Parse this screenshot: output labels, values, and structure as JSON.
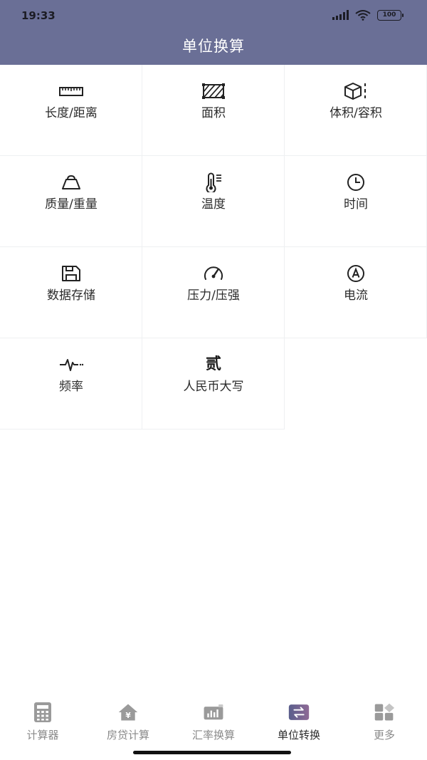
{
  "status": {
    "time": "19:33",
    "battery": "100"
  },
  "header": {
    "title": "单位换算"
  },
  "grid": {
    "items": [
      {
        "label": "长度/距离",
        "icon": "ruler-icon"
      },
      {
        "label": "面积",
        "icon": "area-icon"
      },
      {
        "label": "体积/容积",
        "icon": "cube-icon"
      },
      {
        "label": "质量/重量",
        "icon": "weight-icon"
      },
      {
        "label": "温度",
        "icon": "thermometer-icon"
      },
      {
        "label": "时间",
        "icon": "clock-icon"
      },
      {
        "label": "数据存储",
        "icon": "floppy-disk-icon"
      },
      {
        "label": "压力/压强",
        "icon": "gauge-icon"
      },
      {
        "label": "电流",
        "icon": "ampere-icon"
      },
      {
        "label": "频率",
        "icon": "pulse-wave-icon"
      },
      {
        "label": "人民币大写",
        "icon": "chinese-numeral-icon",
        "glyph": "贰"
      }
    ]
  },
  "tabbar": {
    "tabs": [
      {
        "label": "计算器",
        "icon": "calculator-icon"
      },
      {
        "label": "房贷计算",
        "icon": "house-yuan-icon"
      },
      {
        "label": "汇率换算",
        "icon": "exchange-chart-icon"
      },
      {
        "label": "单位转换",
        "icon": "swap-arrows-icon",
        "active": true
      },
      {
        "label": "更多",
        "icon": "more-grid-icon"
      }
    ]
  }
}
